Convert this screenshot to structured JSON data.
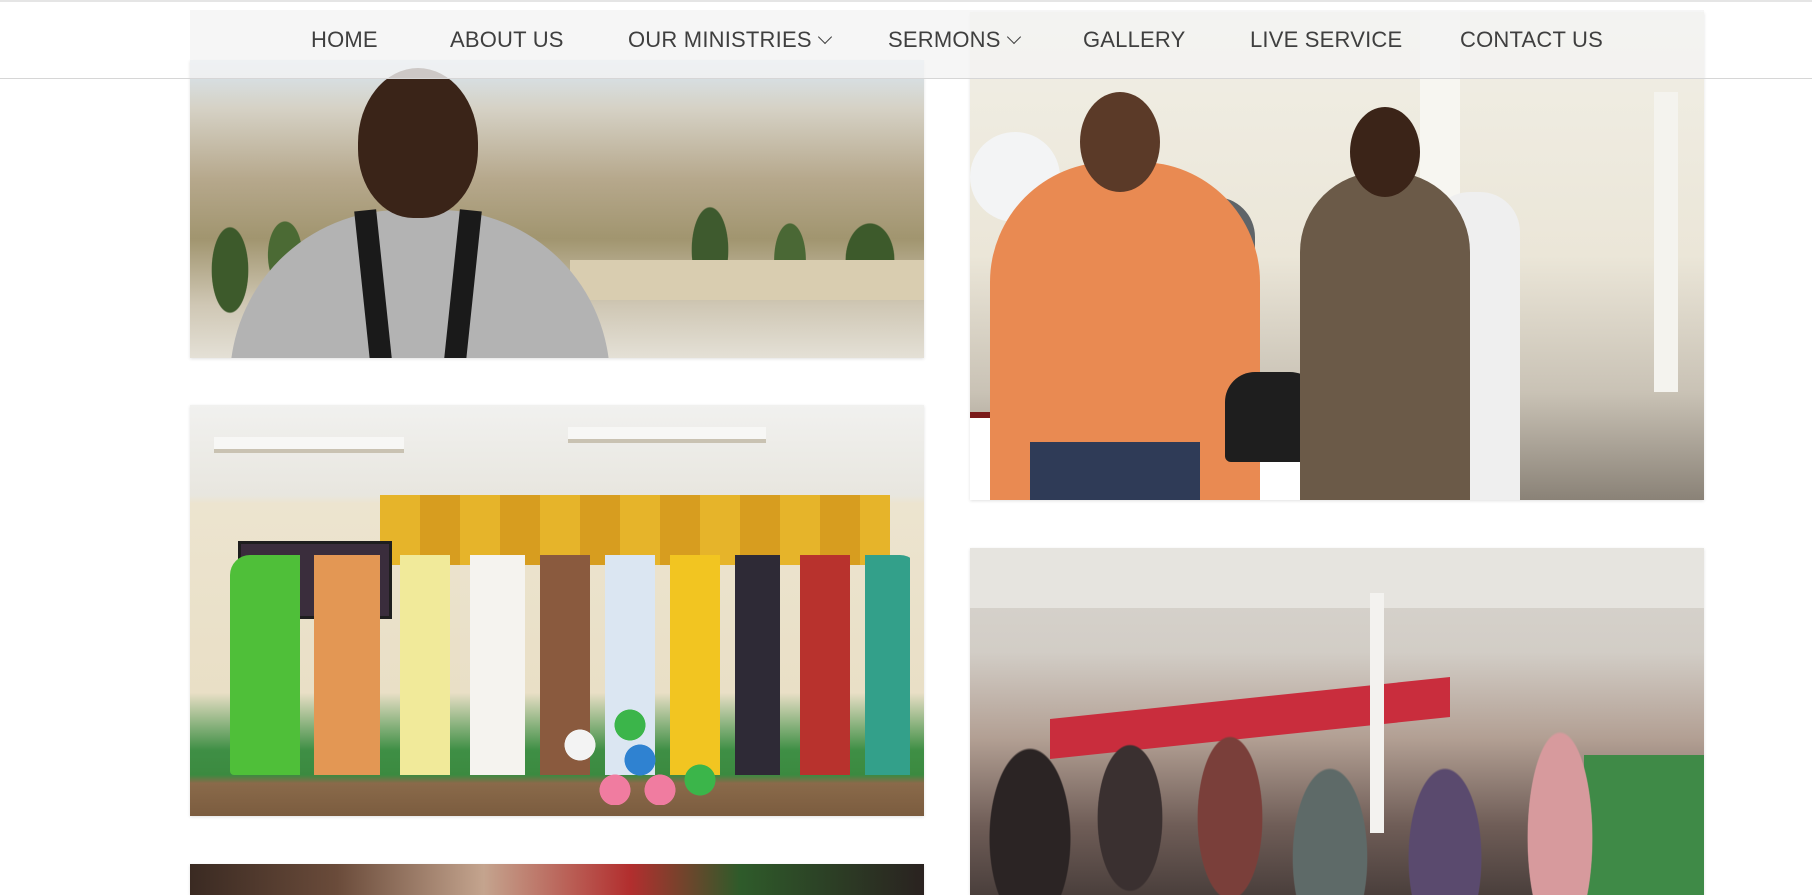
{
  "nav": {
    "items": [
      {
        "label": "HOME",
        "has_dropdown": false
      },
      {
        "label": "ABOUT US",
        "has_dropdown": false
      },
      {
        "label": "OUR MINISTRIES",
        "has_dropdown": true
      },
      {
        "label": "SERMONS",
        "has_dropdown": true
      },
      {
        "label": "GALLERY",
        "has_dropdown": false
      },
      {
        "label": "LIVE SERVICE",
        "has_dropdown": false
      },
      {
        "label": "CONTACT US",
        "has_dropdown": false
      }
    ],
    "text_color": "#3f3f3f"
  },
  "gallery": {
    "photos": [
      {
        "subject": "man-smiling-jerusalem"
      },
      {
        "subject": "men-praying-orange-shirt"
      },
      {
        "subject": "women-choir-stage"
      },
      {
        "subject": "congregation-praying-hall"
      },
      {
        "subject": "partial-photo"
      }
    ]
  },
  "colors": {
    "background": "#ffffff",
    "nav_overlay": "#f4f4f4"
  }
}
